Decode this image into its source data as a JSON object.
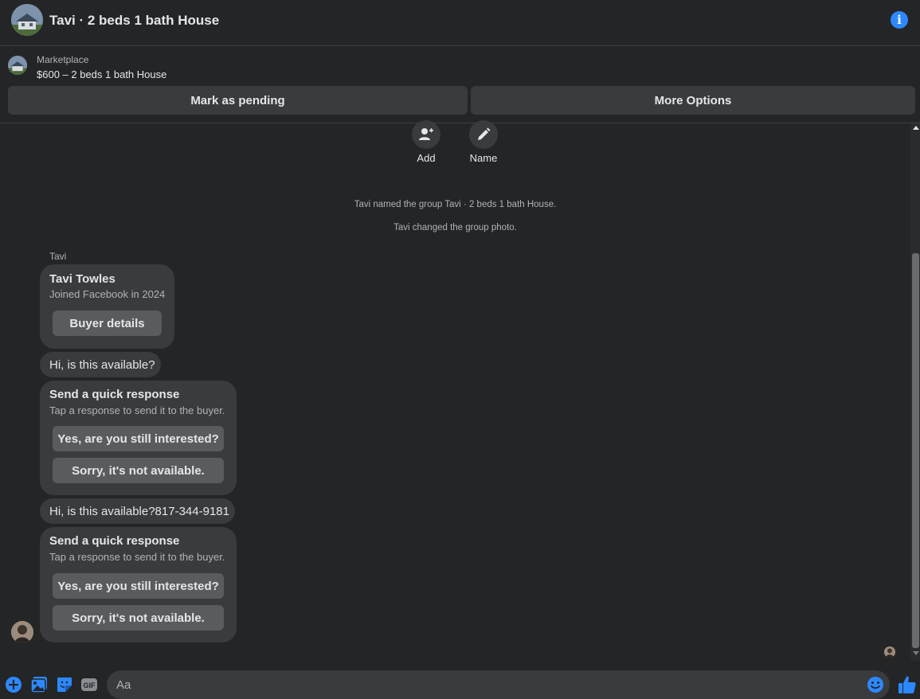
{
  "header": {
    "title": "Tavi · 2 beds 1 bath House"
  },
  "listing": {
    "source": "Marketplace",
    "title": "$600 – 2 beds 1 bath House"
  },
  "actions": {
    "mark_pending": "Mark as pending",
    "more_options": "More Options"
  },
  "group_actions": {
    "add_label": "Add",
    "name_label": "Name"
  },
  "system_messages": [
    "Tavi named the group Tavi · 2 beds 1 bath House.",
    "Tavi changed the group photo."
  ],
  "sender": {
    "name": "Tavi"
  },
  "profile_card": {
    "name": "Tavi Towles",
    "joined": "Joined Facebook in 2024",
    "button": "Buyer details"
  },
  "messages": [
    {
      "text": "Hi, is this available?"
    },
    {
      "text": "Hi, is this available?817-344-9181"
    }
  ],
  "quick_responses": [
    {
      "title": "Send a quick response",
      "subtitle": "Tap a response to send it to the buyer.",
      "options": [
        "Yes, are you still interested?",
        "Sorry, it's not available."
      ]
    },
    {
      "title": "Send a quick response",
      "subtitle": "Tap a response to send it to the buyer.",
      "options": [
        "Yes, are you still interested?",
        "Sorry, it's not available."
      ]
    }
  ],
  "composer": {
    "placeholder": "Aa",
    "gif_label": "GIF"
  },
  "colors": {
    "accent": "#2d88ff",
    "background": "#242526",
    "bubble": "#3a3b3c"
  }
}
